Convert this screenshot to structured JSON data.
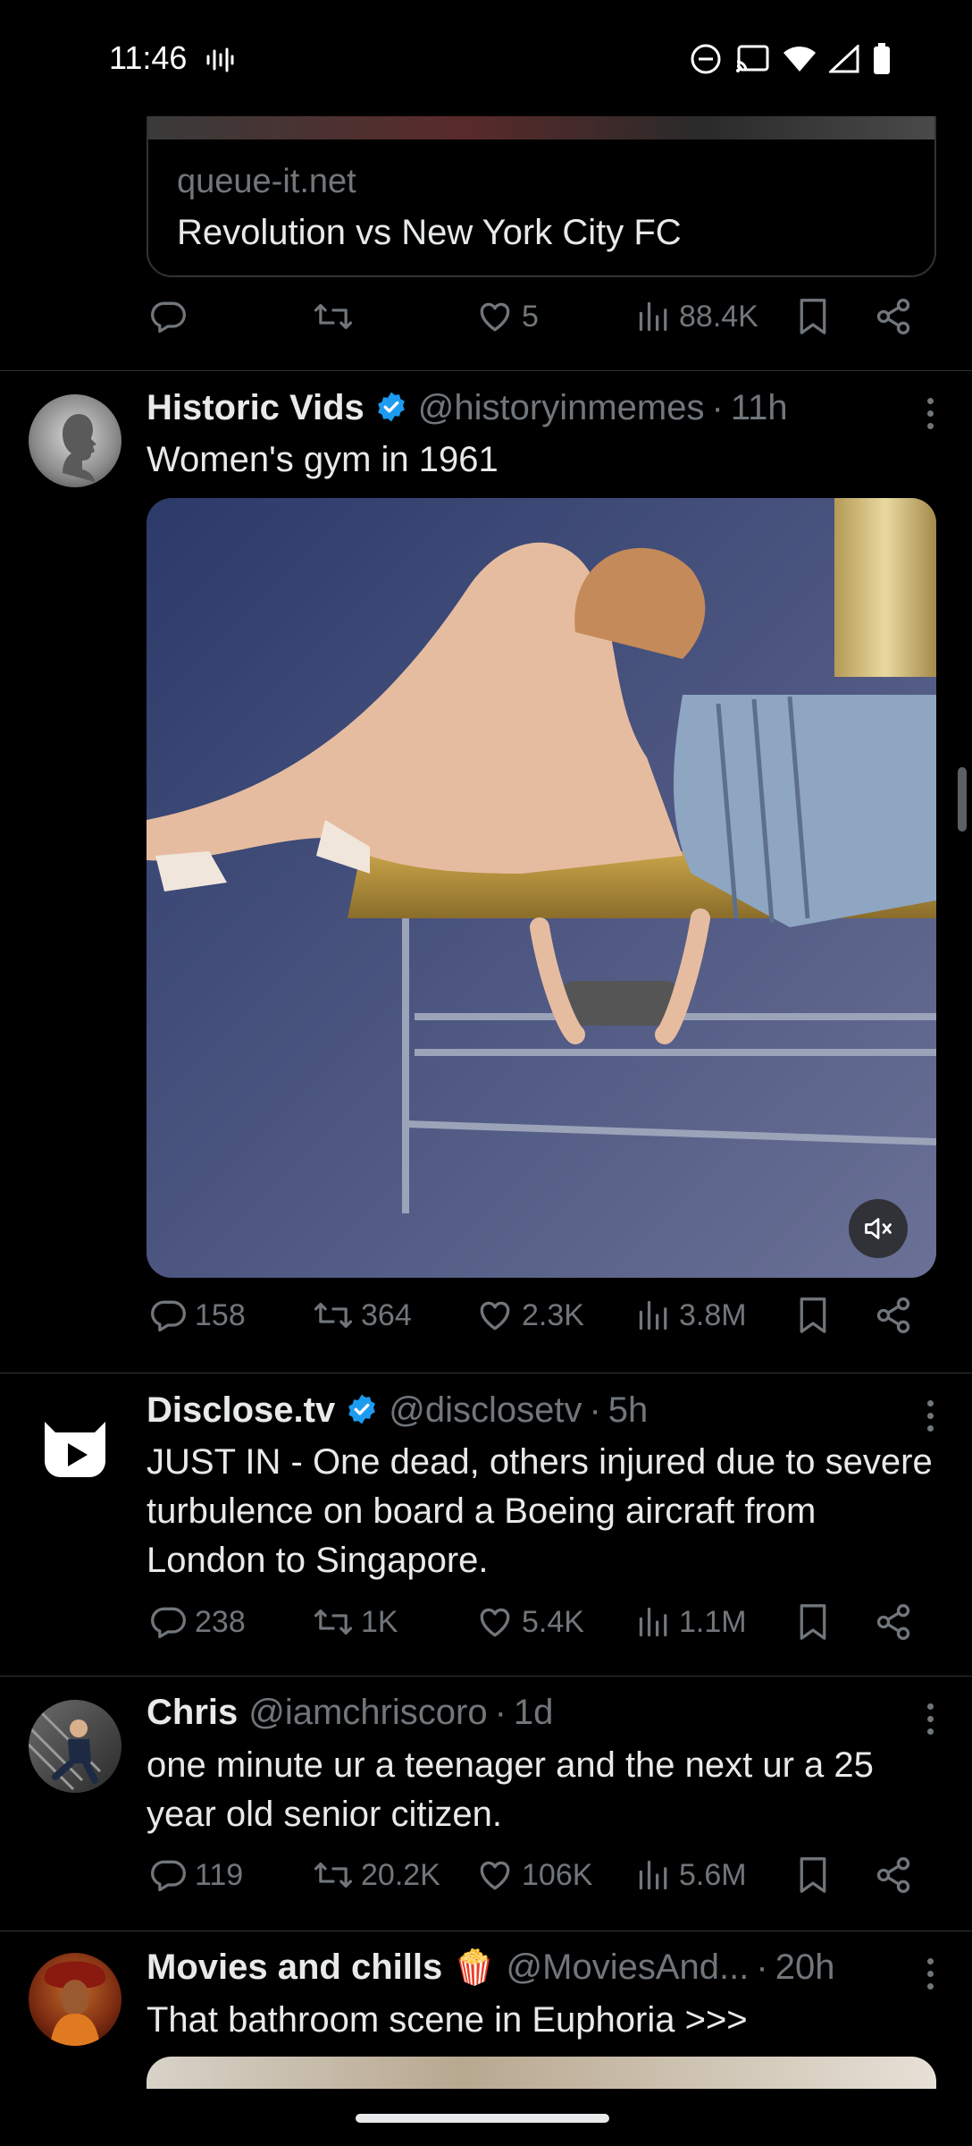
{
  "status_bar": {
    "time": "11:46"
  },
  "tweets": [
    {
      "card": {
        "domain": "queue-it.net",
        "title": "Revolution vs New York City FC"
      },
      "stats": {
        "replies": "",
        "reposts": "",
        "likes": "5",
        "views": "88.4K"
      }
    },
    {
      "name": "Historic Vids",
      "verified": true,
      "handle": "@historyinmemes",
      "time": "11h",
      "text": "Women's gym in 1961",
      "media": "video",
      "stats": {
        "replies": "158",
        "reposts": "364",
        "likes": "2.3K",
        "views": "3.8M"
      }
    },
    {
      "name": "Disclose.tv",
      "verified": true,
      "handle": "@disclosetv",
      "time": "5h",
      "text": "JUST IN - One dead, others injured due to severe turbulence on board a Boeing aircraft from London to Singapore.",
      "stats": {
        "replies": "238",
        "reposts": "1K",
        "likes": "5.4K",
        "views": "1.1M"
      }
    },
    {
      "name": "Chris",
      "handle": "@iamchriscoro",
      "time": "1d",
      "text": "one minute ur a teenager and the next ur a 25 year old senior citizen.",
      "stats": {
        "replies": "119",
        "reposts": "20.2K",
        "likes": "106K",
        "views": "5.6M"
      }
    },
    {
      "name": "Movies and chills",
      "name_emoji": "🍿",
      "handle": "@MoviesAnd...",
      "time": "20h",
      "text": "That bathroom scene in Euphoria >>>"
    }
  ],
  "colors": {
    "background": "#000000",
    "text": "#e7e9ea",
    "muted": "#71767b",
    "verified": "#1d9bf0",
    "divider": "#2f3336"
  },
  "icons": [
    "reply-icon",
    "repost-icon",
    "like-icon",
    "views-icon",
    "bookmark-icon",
    "share-icon",
    "verified-badge-icon",
    "mute-icon",
    "more-icon"
  ]
}
